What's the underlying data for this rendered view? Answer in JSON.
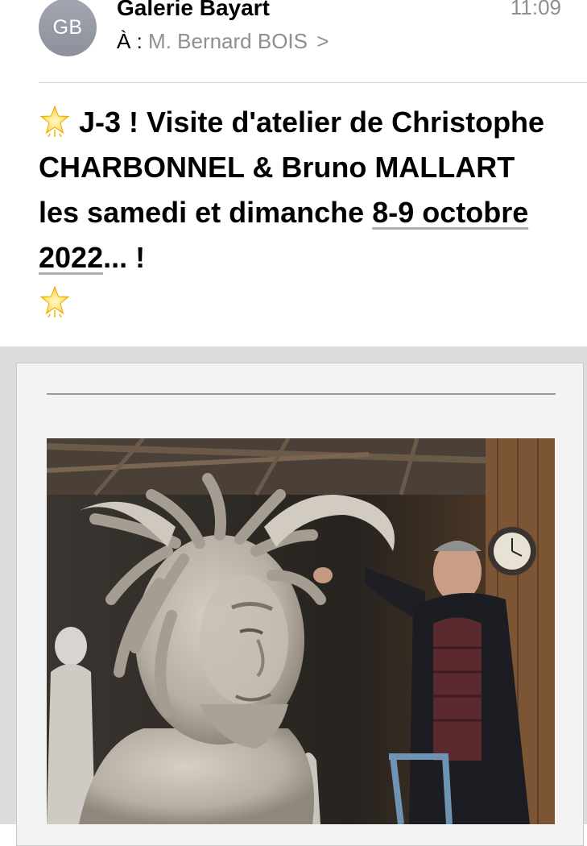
{
  "email": {
    "avatar_initials": "GB",
    "sender": "Galerie Bayart",
    "time": "11:09",
    "to_label": "À :",
    "to_name": "M. Bernard BOIS",
    "subject_part1": "J-3 ! Visite d'atelier de Christophe CHARBONNEL & Bruno MALLART les samedi et dimanche ",
    "subject_date": "8-9 octobre 2022",
    "subject_part2": "... !"
  },
  "icons": {
    "star": "star-emoji-icon",
    "chevron": "chevron-right-icon"
  },
  "colors": {
    "avatar": "#9a9ea8",
    "meta_gray": "#8e8e93",
    "body_bg": "#dcdcdc",
    "card_bg": "#f3f3f3"
  }
}
